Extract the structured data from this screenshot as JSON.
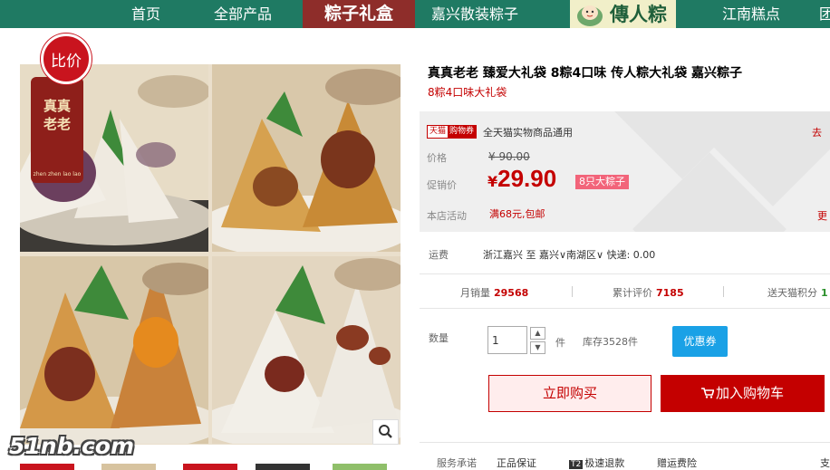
{
  "nav": {
    "items": [
      "首页",
      "全部产品",
      "粽子礼盒",
      "嘉兴散装粽子",
      "傳人粽",
      "江南糕点",
      "团"
    ],
    "active_color": "#8e2d2a",
    "bar_color": "#1f7a63"
  },
  "gallery": {
    "compare_badge": "比价",
    "seal_text": "真真老老",
    "seal_sub": "zhen zhen lao lao",
    "zoom_icon": "magnifier-icon",
    "watermark": "51nb.com"
  },
  "product": {
    "title": "真真老老 臻爱大礼袋 8粽4口味 传人粽大礼袋 嘉兴粽子",
    "subtitle": "8粽4口味大礼袋"
  },
  "price": {
    "tmall_a": "天猫",
    "tmall_b": "购物券",
    "promo_text": "全天猫实物商品通用",
    "promo_link": "去",
    "original_label": "价格",
    "original_value": "¥ 90.00",
    "sale_label": "促销价",
    "currency": "¥",
    "sale_value": "29.90",
    "sale_tag": "8只大粽子",
    "activity_label": "本店活动",
    "activity_text": "满68元,包邮",
    "more_link": "更",
    "accent": "#c40000"
  },
  "shipping": {
    "label": "运费",
    "value": "浙江嘉兴 至 嘉兴∨南湖区∨ 快递: 0.00"
  },
  "stats": [
    {
      "label": "月销量",
      "value": "29568"
    },
    {
      "label": "累计评价",
      "value": "7185"
    },
    {
      "label": "送天猫积分",
      "value": "1"
    }
  ],
  "purchase": {
    "qty_label": "数量",
    "qty_value": "1",
    "qty_unit": "件",
    "stock": "库存3528件",
    "coupon": "优惠券",
    "buy_now": "立即购买",
    "add_cart": "加入购物车"
  },
  "service": {
    "label": "服务承诺",
    "items": [
      "正品保证",
      "极速退款",
      "赠运费险",
      "支"
    ],
    "t2": "T2"
  }
}
